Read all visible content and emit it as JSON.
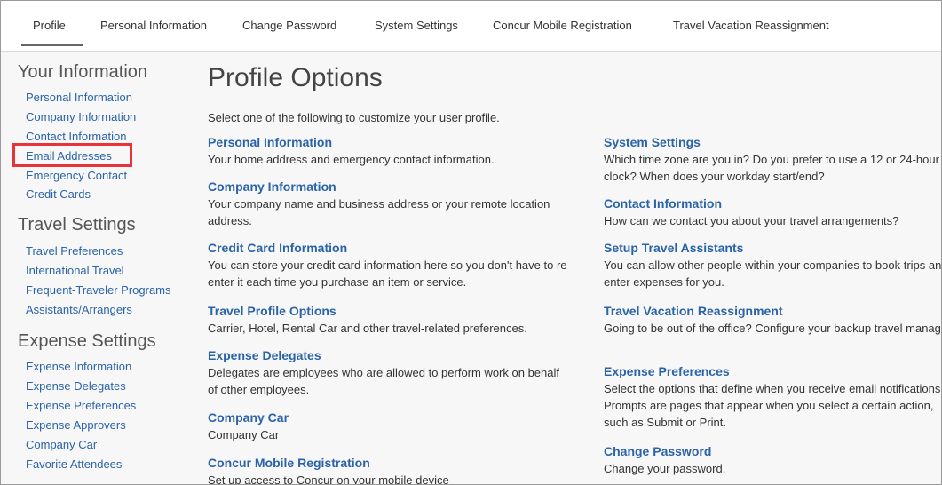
{
  "topnav": {
    "tabs": [
      {
        "label": "Profile"
      },
      {
        "label": "Personal Information"
      },
      {
        "label": "Change Password"
      },
      {
        "label": "System Settings"
      },
      {
        "label": "Concur Mobile Registration"
      },
      {
        "label": "Travel Vacation Reassignment"
      }
    ]
  },
  "sidebar": {
    "your_information": {
      "heading": "Your Information",
      "links": [
        "Personal Information",
        "Company Information",
        "Contact Information",
        "Email Addresses",
        "Emergency Contact",
        "Credit Cards"
      ]
    },
    "travel_settings": {
      "heading": "Travel Settings",
      "links": [
        "Travel Preferences",
        "International Travel",
        "Frequent-Traveler Programs",
        "Assistants/Arrangers"
      ]
    },
    "expense_settings": {
      "heading": "Expense Settings",
      "links": [
        "Expense Information",
        "Expense Delegates",
        "Expense Preferences",
        "Expense Approvers",
        "Company Car",
        "Favorite Attendees"
      ]
    }
  },
  "main": {
    "title": "Profile Options",
    "intro": "Select one of the following to customize your user profile.",
    "left_options": [
      {
        "title": "Personal Information",
        "desc": "Your home address and emergency contact information."
      },
      {
        "title": "Company Information",
        "desc": "Your company name and business address or your remote location address."
      },
      {
        "title": "Credit Card Information",
        "desc": "You can store your credit card information here so you don't have to re-enter it each time you purchase an item or service."
      },
      {
        "title": "Travel Profile Options",
        "desc": "Carrier, Hotel, Rental Car and other travel-related preferences."
      },
      {
        "title": "Expense Delegates",
        "desc": "Delegates are employees who are allowed to perform work on behalf of other employees."
      },
      {
        "title": "Company Car",
        "desc": "Company Car"
      },
      {
        "title": "Concur Mobile Registration",
        "desc": "Set up access to Concur on your mobile device"
      }
    ],
    "right_options": [
      {
        "title": "System Settings",
        "desc": "Which time zone are you in? Do you prefer to use a 12 or 24-hour clock? When does your workday start/end?"
      },
      {
        "title": "Contact Information",
        "desc": "How can we contact you about your travel arrangements?"
      },
      {
        "title": "Setup Travel Assistants",
        "desc": "You can allow other people within your companies to book trips and enter expenses for you."
      },
      {
        "title": "Travel Vacation Reassignment",
        "desc": "Going to be out of the office? Configure your backup travel manager."
      },
      {
        "title": "Expense Preferences",
        "desc": "Select the options that define when you receive email notifications. Prompts are pages that appear when you select a certain action, such as Submit or Print."
      },
      {
        "title": "Change Password",
        "desc": "Change your password."
      }
    ]
  },
  "colors": {
    "link": "#2a63a8",
    "highlight_border": "#e8333b",
    "background": "#f7f7f7"
  }
}
